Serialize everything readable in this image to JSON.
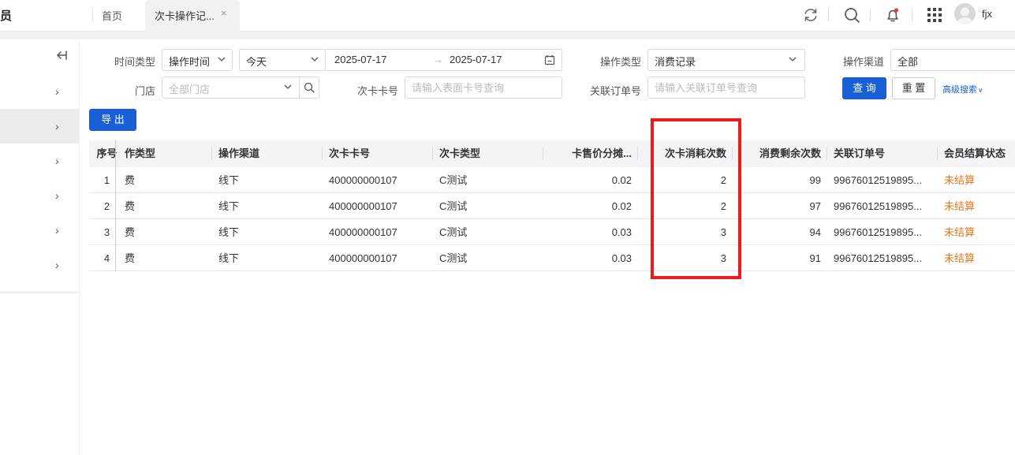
{
  "app": {
    "brand": "员",
    "username": "fjx"
  },
  "tabs": [
    {
      "label": "首页"
    },
    {
      "label": "次卡操作记...",
      "close": "×"
    }
  ],
  "icons": {
    "refresh": "refresh-icon",
    "search": "search-icon",
    "bell": "bell-icon",
    "apps": "grid-icon",
    "avatar": "avatar-icon"
  },
  "colors": {
    "primary": "#1a5fd6",
    "warning": "#e8751a",
    "highlight": "#ee1b1b"
  },
  "filters": {
    "time_type_label": "时间类型",
    "time_type_value": "操作时间",
    "range_value": "今天",
    "date_start": "2025-07-17",
    "date_arrow": "→",
    "date_end": "2025-07-17",
    "op_type_label": "操作类型",
    "op_type_value": "消费记录",
    "channel_label": "操作渠道",
    "channel_value": "全部",
    "store_label": "门店",
    "store_placeholder": "全部门店",
    "card_no_label": "次卡卡号",
    "card_no_placeholder": "请输入表面卡号查询",
    "order_label": "关联订单号",
    "order_placeholder": "请输入关联订单号查询",
    "query_button": "查 询",
    "reset_button": "重 置",
    "advanced_link": "高级搜索",
    "advanced_chevron": "∨"
  },
  "export_button": "导 出",
  "table": {
    "headers": [
      "序号",
      "作类型",
      "操作渠道",
      "次卡卡号",
      "次卡类型",
      "卡售价分摊...",
      "次卡消耗次数",
      "消费剩余次数",
      "关联订单号",
      "会员结算状态"
    ],
    "rows": [
      [
        "1",
        "费",
        "线下",
        "400000000107",
        "C测试",
        "0.02",
        "2",
        "99",
        "99676012519895...",
        "未结算"
      ],
      [
        "2",
        "费",
        "线下",
        "400000000107",
        "C测试",
        "0.02",
        "2",
        "97",
        "99676012519895...",
        "未结算"
      ],
      [
        "3",
        "费",
        "线下",
        "400000000107",
        "C测试",
        "0.03",
        "3",
        "94",
        "99676012519895...",
        "未结算"
      ],
      [
        "4",
        "费",
        "线下",
        "400000000107",
        "C测试",
        "0.03",
        "3",
        "91",
        "99676012519895...",
        "未结算"
      ]
    ]
  },
  "sidebar": {
    "chevron": "›",
    "items": [
      "",
      "",
      "",
      "",
      "",
      ""
    ]
  }
}
